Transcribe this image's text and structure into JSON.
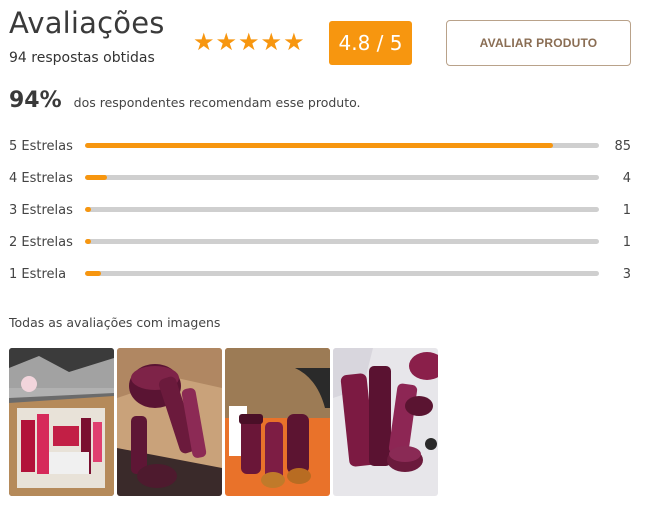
{
  "header": {
    "title": "Avaliações",
    "subtitle": "94 respostas obtidas",
    "star_icon": "star-icon",
    "star_count": 5,
    "score": "4.8 / 5",
    "rate_button": "AVALIAR PRODUTO"
  },
  "recommend": {
    "percent": "94%",
    "text": "dos respondentes recomendam esse produto."
  },
  "ratings": [
    {
      "label": "5 Estrelas",
      "count": "85",
      "fraction": 0.91
    },
    {
      "label": "4 Estrelas",
      "count": "4",
      "fraction": 0.043
    },
    {
      "label": "3 Estrelas",
      "count": "1",
      "fraction": 0.011
    },
    {
      "label": "2 Estrelas",
      "count": "1",
      "fraction": 0.011
    },
    {
      "label": "1 Estrela",
      "count": "3",
      "fraction": 0.032
    }
  ],
  "images": {
    "title": "Todas as avaliações com imagens",
    "count": 4
  },
  "colors": {
    "accent": "#f7960f",
    "track": "#cfcfcf",
    "button_text": "#8a6d53",
    "button_border": "#b9a28a"
  }
}
